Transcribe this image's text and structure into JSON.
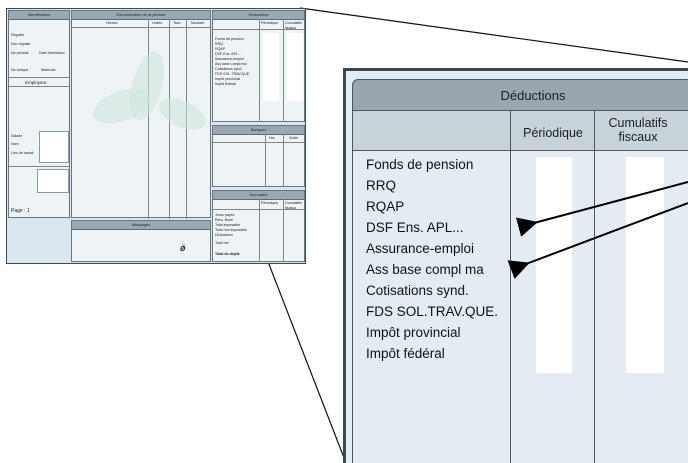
{
  "stub": {
    "identification_title": "Identification",
    "id_rows": [
      "Régulier",
      "Non régulier",
      "No période",
      "No chèque"
    ],
    "id_extra": [
      "Date d'émission",
      "Matricule"
    ],
    "employeur_label": "Employeur",
    "left_rows": [
      "Salaire",
      "Nom",
      "Lieu de travail"
    ],
    "page_label": "Page : 1",
    "remuneration_title": "Rémunération de la période",
    "remuneration_cols": [
      "Heures",
      "Unités",
      "Taux",
      "Montant"
    ],
    "deductions_title": "Déductions",
    "deductions_cols": [
      "Périodique",
      "Cumulatifs fiscaux"
    ],
    "deductions_items": [
      "Fonds de pension",
      "RRQ",
      "RQAP",
      "DSF Ens. APL...",
      "Assurance-emploi",
      "Ass base compl ma",
      "Cotisations synd.",
      "FDS SOL.TRAV.QUE.",
      "Impôt provincial",
      "Impôt fédéral"
    ],
    "banque_title": "Banques",
    "banque_cols": [
      "Hrs",
      "Solde"
    ],
    "sommaire_title": "Sommaire",
    "sommaire_cols": [
      "Périodique",
      "Cumulatifs fiscaux"
    ],
    "sommaire_items": [
      "Jours payés",
      "Rém. Brute",
      "Total imposable",
      "Total non imposable",
      "Déductions",
      "Total net",
      "Total du dépôt"
    ],
    "messages_title": "Messages"
  },
  "zoom": {
    "title": "Déductions",
    "col_periodique": "Périodique",
    "col_cumulatifs": "Cumulatifs fiscaux",
    "items": [
      "Fonds de pension",
      "RRQ",
      "RQAP",
      "DSF Ens. APL...",
      "Assurance-emploi",
      "Ass base compl ma",
      "Cotisations synd.",
      "FDS SOL.TRAV.QUE.",
      "Impôt provincial",
      "Impôt fédéral"
    ]
  },
  "colors": {
    "panel_blue": "#d9e6ee",
    "header_gray": "#9aa6ae",
    "border": "#3f4b55",
    "arrow": "#000000"
  }
}
